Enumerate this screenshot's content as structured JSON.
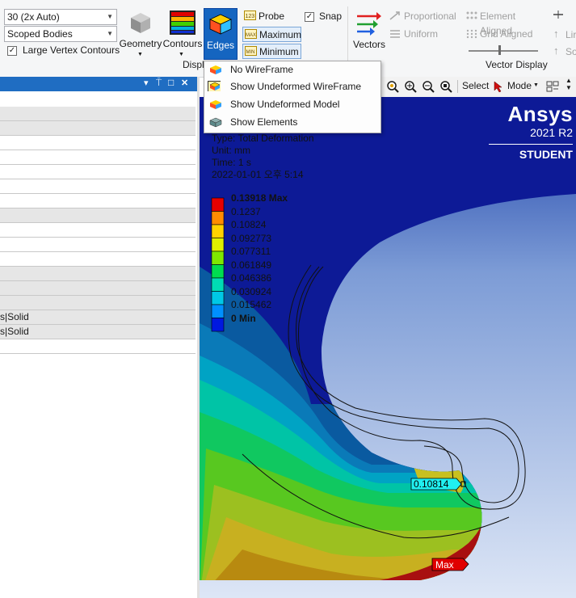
{
  "ribbon": {
    "resolution_combo": "30 (2x Auto)",
    "scope_combo": "Scoped Bodies",
    "large_vertex_label": "Large Vertex Contours",
    "large_vertex_checked": true,
    "geometry_label": "Geometry",
    "contours_label": "Contours",
    "edges_label": "Edges",
    "display_group_label": "Display",
    "probe_label": "Probe",
    "maximum_label": "Maximum",
    "minimum_label": "Minimum",
    "snap_label": "Snap",
    "snap_checked": true,
    "vectors_label": "Vectors",
    "proportional_label": "Proportional",
    "uniform_label": "Uniform",
    "element_aligned_label": "Element Aligned",
    "grid_aligned_label": "Grid Aligned",
    "vector_display_group_label": "Vector Display",
    "line_partial": "Lir",
    "solid_partial": "So"
  },
  "edges_menu": {
    "items": [
      {
        "label": "No WireFrame",
        "icon": "colored-cube-icon"
      },
      {
        "label": "Show Undeformed WireFrame",
        "icon": "wireframe-cube-icon"
      },
      {
        "label": "Show Undeformed Model",
        "icon": "colored-cube-icon"
      },
      {
        "label": "Show Elements",
        "icon": "mesh-cube-icon"
      }
    ]
  },
  "left_panel": {
    "header_icons": [
      "▾",
      "⍑",
      "□",
      "✕"
    ],
    "rows": [
      {
        "text": "",
        "style": "gray"
      },
      {
        "text": "",
        "style": "gray"
      },
      {
        "text": "",
        "style": "white"
      },
      {
        "text": "",
        "style": "white"
      },
      {
        "text": "",
        "style": "white"
      },
      {
        "text": "",
        "style": "white"
      },
      {
        "text": "",
        "style": "white"
      },
      {
        "text": "",
        "style": "gray"
      },
      {
        "text": "",
        "style": "white"
      },
      {
        "text": "",
        "style": "white"
      },
      {
        "text": "",
        "style": "white"
      },
      {
        "text": "",
        "style": "gray"
      },
      {
        "text": "",
        "style": "gray"
      },
      {
        "text": "",
        "style": "gray"
      },
      {
        "text": "s|Solid",
        "style": "gray"
      },
      {
        "text": "s|Solid",
        "style": "gray"
      },
      {
        "text": "",
        "style": "white"
      }
    ]
  },
  "viewport_toolbar": {
    "select_label": "Select",
    "mode_label": "Mode"
  },
  "viewport": {
    "brand": "Ansys",
    "version": "2021 R2",
    "edition": "STUDENT",
    "type_line": "Type: Total Deformation",
    "unit_line": "Unit: mm",
    "time_line": "Time: 1 s",
    "date_line": "2022-01-01 오후 5:14",
    "probe_value": "0.10814",
    "max_tag": "Max"
  },
  "legend": {
    "labels": [
      "0.13918 Max",
      "0.1237",
      "0.10824",
      "0.092773",
      "0.077311",
      "0.061849",
      "0.046386",
      "0.030924",
      "0.015462",
      "0 Min"
    ],
    "colors": [
      "#e60000",
      "#ff8c00",
      "#ffd200",
      "#e0f000",
      "#7ee800",
      "#00dc50",
      "#00dcb4",
      "#00c8e6",
      "#0090ff",
      "#0018e0"
    ]
  }
}
